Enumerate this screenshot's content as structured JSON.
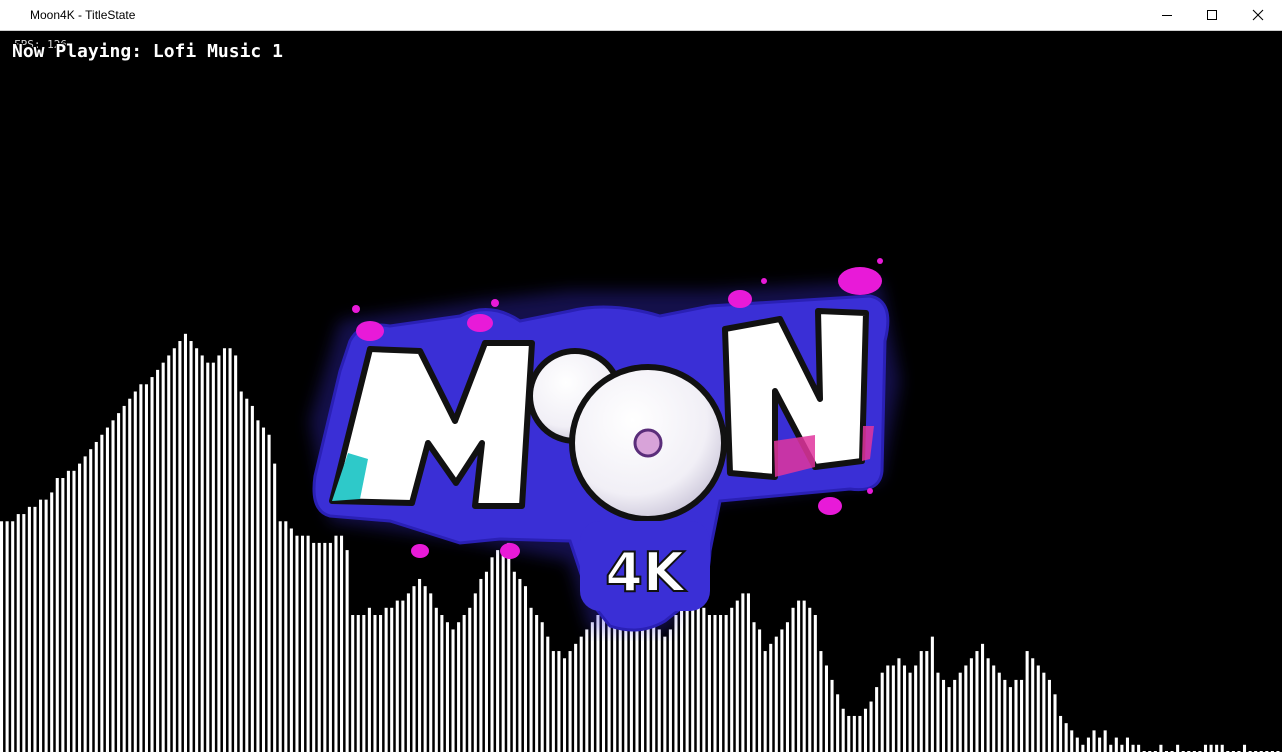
{
  "window": {
    "title": "Moon4K - TitleState",
    "controls": [
      "minimize-icon",
      "maximize-icon",
      "close-icon"
    ]
  },
  "hud": {
    "fps_text": "FPS: 126",
    "now_playing_text": "Now Playing: Lofi Music 1"
  },
  "logo": {
    "main_text": "MOON",
    "sub_text": "4K",
    "colors": {
      "outline": "#3a2fd6",
      "splatter": "#e81ad8",
      "letter_fill": "#ffffff",
      "letter_edge_left": "#2ec9c9",
      "letter_edge_right": "#e0359d",
      "stroke": "#111111"
    }
  },
  "visualizer": {
    "bar_color": "#ffffff",
    "background": "#000000",
    "levels": [
      0.32,
      0.32,
      0.32,
      0.33,
      0.33,
      0.34,
      0.34,
      0.35,
      0.35,
      0.36,
      0.38,
      0.38,
      0.39,
      0.39,
      0.4,
      0.41,
      0.42,
      0.43,
      0.44,
      0.45,
      0.46,
      0.47,
      0.48,
      0.49,
      0.5,
      0.51,
      0.51,
      0.52,
      0.53,
      0.54,
      0.55,
      0.56,
      0.57,
      0.58,
      0.57,
      0.56,
      0.55,
      0.54,
      0.54,
      0.55,
      0.56,
      0.56,
      0.55,
      0.5,
      0.49,
      0.48,
      0.46,
      0.45,
      0.44,
      0.4,
      0.32,
      0.32,
      0.31,
      0.3,
      0.3,
      0.3,
      0.29,
      0.29,
      0.29,
      0.29,
      0.3,
      0.3,
      0.28,
      0.19,
      0.19,
      0.19,
      0.2,
      0.19,
      0.19,
      0.2,
      0.2,
      0.21,
      0.21,
      0.22,
      0.23,
      0.24,
      0.23,
      0.22,
      0.2,
      0.19,
      0.18,
      0.17,
      0.18,
      0.19,
      0.2,
      0.22,
      0.24,
      0.25,
      0.27,
      0.28,
      0.28,
      0.29,
      0.25,
      0.24,
      0.23,
      0.2,
      0.19,
      0.18,
      0.16,
      0.14,
      0.14,
      0.13,
      0.14,
      0.15,
      0.16,
      0.17,
      0.18,
      0.19,
      0.21,
      0.24,
      0.26,
      0.28,
      0.3,
      0.29,
      0.27,
      0.24,
      0.23,
      0.2,
      0.17,
      0.16,
      0.17,
      0.19,
      0.21,
      0.22,
      0.23,
      0.24,
      0.2,
      0.19,
      0.19,
      0.19,
      0.19,
      0.2,
      0.21,
      0.22,
      0.22,
      0.18,
      0.17,
      0.14,
      0.15,
      0.16,
      0.17,
      0.18,
      0.2,
      0.21,
      0.21,
      0.2,
      0.19,
      0.14,
      0.12,
      0.1,
      0.08,
      0.06,
      0.05,
      0.05,
      0.05,
      0.06,
      0.07,
      0.09,
      0.11,
      0.12,
      0.12,
      0.13,
      0.12,
      0.11,
      0.12,
      0.14,
      0.14,
      0.16,
      0.11,
      0.1,
      0.09,
      0.1,
      0.11,
      0.12,
      0.13,
      0.14,
      0.15,
      0.13,
      0.12,
      0.11,
      0.1,
      0.09,
      0.1,
      0.1,
      0.14,
      0.13,
      0.12,
      0.11,
      0.1,
      0.08,
      0.05,
      0.04,
      0.03,
      0.02,
      0.01,
      0.02,
      0.03,
      0.02,
      0.03,
      0.01,
      0.02,
      0.01,
      0.02,
      0.01,
      0.01,
      0.0,
      0.0,
      0.0,
      0.01,
      0.0,
      0.0,
      0.01,
      0.0,
      0.0,
      0.0,
      0.0,
      0.01,
      0.01,
      0.01,
      0.01,
      0.0,
      0.0,
      0.0,
      0.01,
      0.0,
      0.0,
      0.0,
      0.0,
      0.0,
      0.0
    ]
  }
}
